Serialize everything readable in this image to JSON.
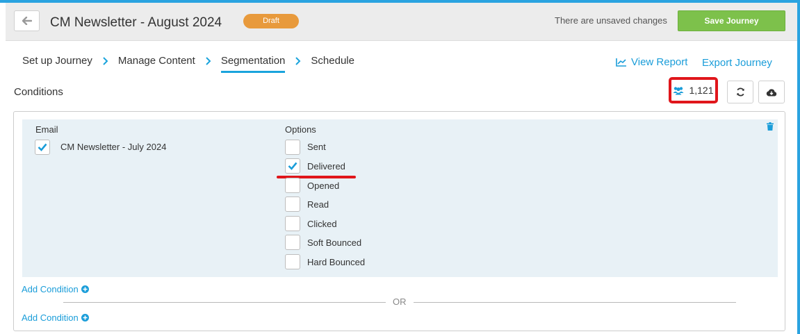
{
  "header": {
    "title": "CM Newsletter - August 2024",
    "status_badge": "Draft",
    "unsaved_text": "There are unsaved changes",
    "save_label": "Save Journey"
  },
  "steps": [
    {
      "label": "Set up Journey"
    },
    {
      "label": "Manage Content"
    },
    {
      "label": "Segmentation",
      "active": true
    },
    {
      "label": "Schedule"
    }
  ],
  "links": {
    "view_report": "View Report",
    "export_journey": "Export Journey"
  },
  "conditions": {
    "title": "Conditions",
    "audience_count": "1,121",
    "email_header": "Email",
    "options_header": "Options",
    "email": {
      "label": "CM Newsletter - July 2024",
      "checked": true
    },
    "options": [
      {
        "label": "Sent",
        "checked": false
      },
      {
        "label": "Delivered",
        "checked": true
      },
      {
        "label": "Opened",
        "checked": false
      },
      {
        "label": "Read",
        "checked": false
      },
      {
        "label": "Clicked",
        "checked": false
      },
      {
        "label": "Soft Bounced",
        "checked": false
      },
      {
        "label": "Hard Bounced",
        "checked": false
      }
    ],
    "add_condition": "Add Condition",
    "or_label": "OR"
  },
  "icons": {
    "back": "arrow-left-icon",
    "chart": "line-chart-icon",
    "users": "users-icon",
    "refresh": "refresh-icon",
    "download": "cloud-download-icon",
    "trash": "trash-icon",
    "plus": "plus-circle-icon",
    "check": "check-icon"
  },
  "colors": {
    "accent": "#1a9dd9",
    "save": "#7dc14b",
    "draft": "#e89a3c",
    "highlight": "#e0161b"
  }
}
